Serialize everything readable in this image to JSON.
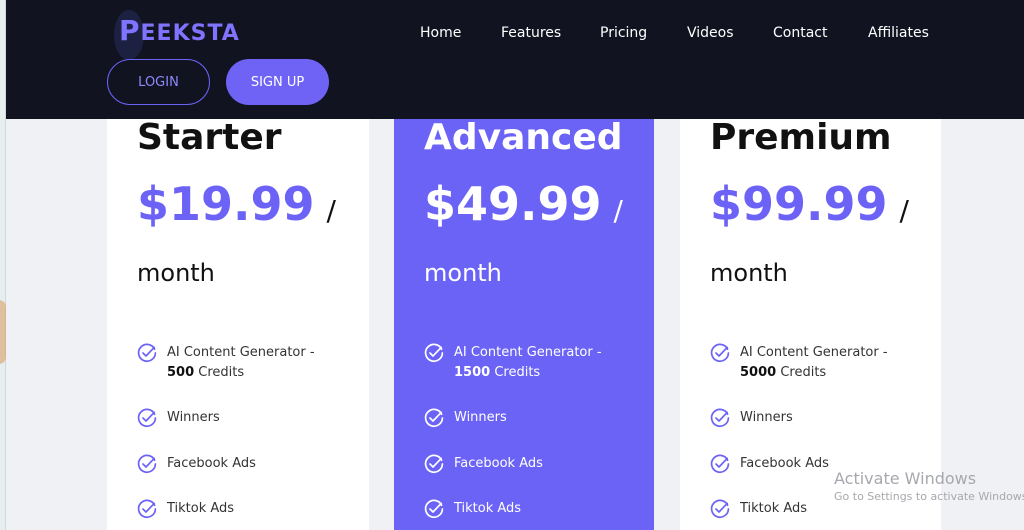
{
  "header": {
    "logo_first": "P",
    "logo_rest": "EEKSTA",
    "nav": [
      "Home",
      "Features",
      "Pricing",
      "Videos",
      "Contact",
      "Affiliates"
    ],
    "login_label": "LOGIN",
    "signup_label": "SIGN UP"
  },
  "plans": [
    {
      "title": "Starter",
      "price": "$19.99",
      "slash": "/",
      "period": "month",
      "features": [
        {
          "pre": "AI Content Generator - ",
          "bold": "500",
          "post": " Credits"
        },
        {
          "pre": "Winners",
          "bold": "",
          "post": ""
        },
        {
          "pre": "Facebook Ads",
          "bold": "",
          "post": ""
        },
        {
          "pre": "Tiktok Ads",
          "bold": "",
          "post": ""
        }
      ]
    },
    {
      "title": "Advanced",
      "price": "$49.99",
      "slash": "/",
      "period": "month",
      "features": [
        {
          "pre": "AI Content Generator - ",
          "bold": "1500",
          "post": " Credits"
        },
        {
          "pre": "Winners",
          "bold": "",
          "post": ""
        },
        {
          "pre": "Facebook Ads",
          "bold": "",
          "post": ""
        },
        {
          "pre": "Tiktok Ads",
          "bold": "",
          "post": ""
        }
      ]
    },
    {
      "title": "Premium",
      "price": "$99.99",
      "slash": "/",
      "period": "month",
      "features": [
        {
          "pre": "AI Content Generator - ",
          "bold": "5000",
          "post": " Credits"
        },
        {
          "pre": "Winners",
          "bold": "",
          "post": ""
        },
        {
          "pre": "Facebook Ads",
          "bold": "",
          "post": ""
        },
        {
          "pre": "Tiktok Ads",
          "bold": "",
          "post": ""
        }
      ]
    }
  ],
  "watermark": {
    "title": "Activate Windows",
    "subtitle": "Go to Settings to activate Windows."
  },
  "colors": {
    "accent": "#6c63f6",
    "header_bg": "#111420"
  },
  "icons": {
    "check": "check-circle-icon"
  }
}
